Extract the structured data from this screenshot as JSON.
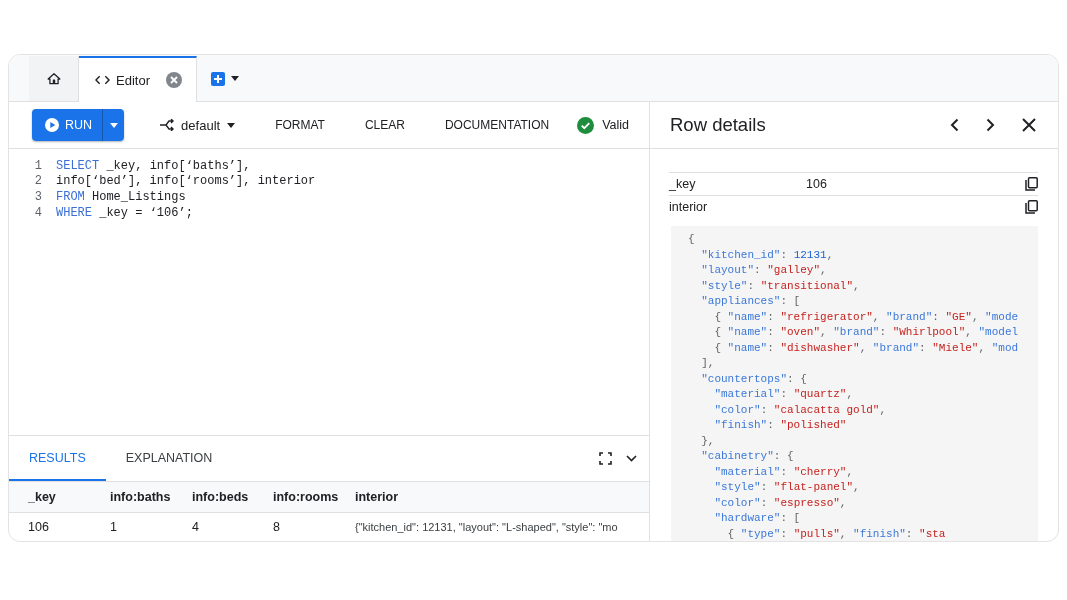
{
  "tabs": [
    {
      "kind": "home",
      "selected": false
    },
    {
      "kind": "editor",
      "label": "Editor",
      "selected": true
    }
  ],
  "toolbar": {
    "run": "RUN",
    "profile": "default",
    "buttons": [
      "FORMAT",
      "CLEAR",
      "DOCUMENTATION"
    ],
    "status": {
      "text": "Valid",
      "valid": true
    }
  },
  "editor": {
    "lines": [
      {
        "number": "1",
        "tokens": [
          {
            "kind": "keyword",
            "text": "SELECT"
          },
          {
            "kind": "plain",
            "text": " _key, info[‘baths’],"
          }
        ]
      },
      {
        "number": "2",
        "tokens": [
          {
            "kind": "plain",
            "text": "info[‘bed’], info[‘rooms’], interior"
          }
        ]
      },
      {
        "number": "3",
        "tokens": [
          {
            "kind": "keyword",
            "text": "FROM"
          },
          {
            "kind": "plain",
            "text": " Home_Listings"
          }
        ]
      },
      {
        "number": "4",
        "tokens": [
          {
            "kind": "keyword",
            "text": "WHERE"
          },
          {
            "kind": "plain",
            "text": " _key = ‘106’;"
          }
        ]
      }
    ]
  },
  "results": {
    "tabs": [
      {
        "label": "RESULTS",
        "selected": true
      },
      {
        "label": "EXPLANATION",
        "selected": false
      }
    ],
    "columns": [
      "_key",
      "info:baths",
      "info:beds",
      "info:rooms",
      "interior"
    ],
    "rows": [
      [
        "106",
        "1",
        "4",
        "8",
        "{\"kitchen_id\": 12131, \"layout\": \"L-shaped\", \"style\": \"mo"
      ]
    ]
  },
  "row_details": {
    "title": "Row details",
    "fields": [
      {
        "name": "_key",
        "value": "106"
      },
      {
        "name": "interior"
      }
    ],
    "json_lines": [
      [
        {
          "kind": "punct",
          "text": "{"
        }
      ],
      [
        {
          "kind": "key",
          "text": "  \"kitchen_id\""
        },
        {
          "kind": "punct",
          "text": ": "
        },
        {
          "kind": "number",
          "text": "12131"
        },
        {
          "kind": "punct",
          "text": ","
        }
      ],
      [
        {
          "kind": "key",
          "text": "  \"layout\""
        },
        {
          "kind": "punct",
          "text": ": "
        },
        {
          "kind": "string",
          "text": "\"galley\""
        },
        {
          "kind": "punct",
          "text": ","
        }
      ],
      [
        {
          "kind": "key",
          "text": "  \"style\""
        },
        {
          "kind": "punct",
          "text": ": "
        },
        {
          "kind": "string",
          "text": "\"transitional\""
        },
        {
          "kind": "punct",
          "text": ","
        }
      ],
      [
        {
          "kind": "key",
          "text": "  \"appliances\""
        },
        {
          "kind": "punct",
          "text": ": ["
        }
      ],
      [
        {
          "kind": "punct",
          "text": "    { "
        },
        {
          "kind": "key",
          "text": "\"name\""
        },
        {
          "kind": "punct",
          "text": ": "
        },
        {
          "kind": "string",
          "text": "\"refrigerator\""
        },
        {
          "kind": "punct",
          "text": ", "
        },
        {
          "kind": "key",
          "text": "\"brand\""
        },
        {
          "kind": "punct",
          "text": ": "
        },
        {
          "kind": "string",
          "text": "\"GE\""
        },
        {
          "kind": "punct",
          "text": ", "
        },
        {
          "kind": "key",
          "text": "\"mode"
        }
      ],
      [
        {
          "kind": "punct",
          "text": "    { "
        },
        {
          "kind": "key",
          "text": "\"name\""
        },
        {
          "kind": "punct",
          "text": ": "
        },
        {
          "kind": "string",
          "text": "\"oven\""
        },
        {
          "kind": "punct",
          "text": ", "
        },
        {
          "kind": "key",
          "text": "\"brand\""
        },
        {
          "kind": "punct",
          "text": ": "
        },
        {
          "kind": "string",
          "text": "\"Whirlpool\""
        },
        {
          "kind": "punct",
          "text": ", "
        },
        {
          "kind": "key",
          "text": "\"model"
        }
      ],
      [
        {
          "kind": "punct",
          "text": "    { "
        },
        {
          "kind": "key",
          "text": "\"name\""
        },
        {
          "kind": "punct",
          "text": ": "
        },
        {
          "kind": "string",
          "text": "\"dishwasher\""
        },
        {
          "kind": "punct",
          "text": ", "
        },
        {
          "kind": "key",
          "text": "\"brand\""
        },
        {
          "kind": "punct",
          "text": ": "
        },
        {
          "kind": "string",
          "text": "\"Miele\""
        },
        {
          "kind": "punct",
          "text": ", "
        },
        {
          "kind": "key",
          "text": "\"mod"
        }
      ],
      [
        {
          "kind": "punct",
          "text": "  ],"
        }
      ],
      [
        {
          "kind": "key",
          "text": "  \"countertops\""
        },
        {
          "kind": "punct",
          "text": ": {"
        }
      ],
      [
        {
          "kind": "key",
          "text": "    \"material\""
        },
        {
          "kind": "punct",
          "text": ": "
        },
        {
          "kind": "string",
          "text": "\"quartz\""
        },
        {
          "kind": "punct",
          "text": ","
        }
      ],
      [
        {
          "kind": "key",
          "text": "    \"color\""
        },
        {
          "kind": "punct",
          "text": ": "
        },
        {
          "kind": "string",
          "text": "\"calacatta gold\""
        },
        {
          "kind": "punct",
          "text": ","
        }
      ],
      [
        {
          "kind": "key",
          "text": "    \"finish\""
        },
        {
          "kind": "punct",
          "text": ": "
        },
        {
          "kind": "string",
          "text": "\"polished\""
        }
      ],
      [
        {
          "kind": "punct",
          "text": "  },"
        }
      ],
      [
        {
          "kind": "key",
          "text": "  \"cabinetry\""
        },
        {
          "kind": "punct",
          "text": ": {"
        }
      ],
      [
        {
          "kind": "key",
          "text": "    \"material\""
        },
        {
          "kind": "punct",
          "text": ": "
        },
        {
          "kind": "string",
          "text": "\"cherry\""
        },
        {
          "kind": "punct",
          "text": ","
        }
      ],
      [
        {
          "kind": "key",
          "text": "    \"style\""
        },
        {
          "kind": "punct",
          "text": ": "
        },
        {
          "kind": "string",
          "text": "\"flat-panel\""
        },
        {
          "kind": "punct",
          "text": ","
        }
      ],
      [
        {
          "kind": "key",
          "text": "    \"color\""
        },
        {
          "kind": "punct",
          "text": ": "
        },
        {
          "kind": "string",
          "text": "\"espresso\""
        },
        {
          "kind": "punct",
          "text": ","
        }
      ],
      [
        {
          "kind": "key",
          "text": "    \"hardware\""
        },
        {
          "kind": "punct",
          "text": ": ["
        }
      ],
      [
        {
          "kind": "punct",
          "text": "      { "
        },
        {
          "kind": "key",
          "text": "\"type\""
        },
        {
          "kind": "punct",
          "text": ": "
        },
        {
          "kind": "string",
          "text": "\"pulls\""
        },
        {
          "kind": "punct",
          "text": ", "
        },
        {
          "kind": "key",
          "text": "\"finish\""
        },
        {
          "kind": "punct",
          "text": ": "
        },
        {
          "kind": "string",
          "text": "\"sta"
        }
      ]
    ]
  }
}
